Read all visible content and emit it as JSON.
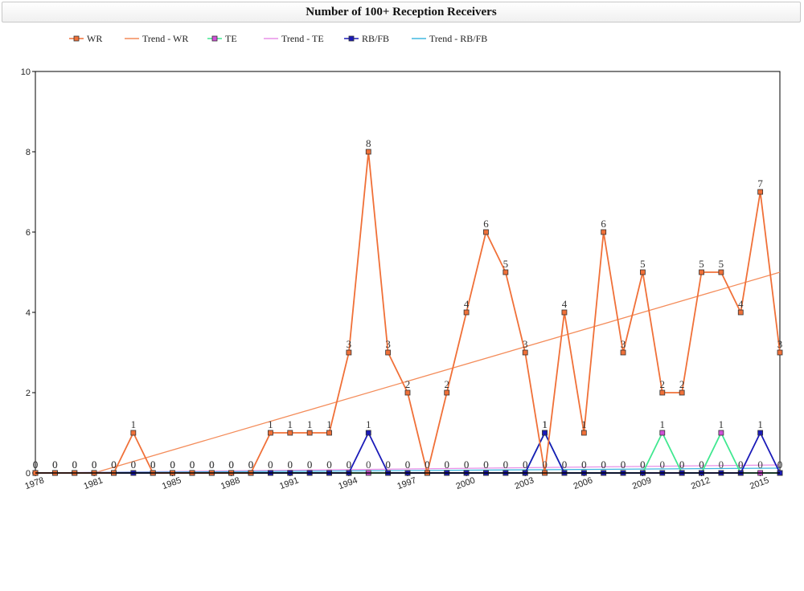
{
  "chart_data": {
    "type": "line",
    "title": "Number of 100+ Reception Receivers",
    "xlabel": "",
    "ylabel": "",
    "xlim": [
      1978,
      2016
    ],
    "ylim": [
      0,
      10
    ],
    "yticks": [
      0,
      2,
      4,
      6,
      8,
      10
    ],
    "xticks": [
      1978,
      1981,
      1985,
      1988,
      1991,
      1994,
      1997,
      2000,
      2003,
      2006,
      2009,
      2012,
      2015
    ],
    "xtick_labels": [
      "1978",
      "1981",
      "1985",
      "1988",
      "1991",
      "1994",
      "1997",
      "2000",
      "2003",
      "2006",
      "2009",
      "2012",
      "2015"
    ],
    "legend_position": "top-left",
    "grid": false,
    "x": [
      1978,
      1979,
      1980,
      1981,
      1982,
      1983,
      1984,
      1985,
      1986,
      1987,
      1988,
      1989,
      1990,
      1991,
      1992,
      1993,
      1994,
      1995,
      1996,
      1997,
      1998,
      1999,
      2000,
      2001,
      2002,
      2003,
      2004,
      2005,
      2006,
      2007,
      2008,
      2009,
      2010,
      2011,
      2012,
      2013,
      2014,
      2015,
      2016
    ],
    "series": [
      {
        "name": "WR",
        "color": "#f07038",
        "marker": "square",
        "labels": true,
        "values": [
          0,
          0,
          0,
          0,
          0,
          1,
          0,
          0,
          0,
          0,
          0,
          0,
          1,
          1,
          1,
          1,
          3,
          8,
          3,
          2,
          0,
          2,
          4,
          6,
          5,
          3,
          0,
          4,
          1,
          6,
          3,
          5,
          2,
          2,
          5,
          5,
          4,
          7,
          3,
          5
        ]
      },
      {
        "name": "Trend - WR",
        "color": "#f48c5a",
        "trend": true,
        "x": [
          1981,
          2016
        ],
        "values": [
          0,
          5
        ]
      },
      {
        "name": "TE",
        "color": "#40e890",
        "marker": "square",
        "marker_fill": "#d050d8",
        "labels": true,
        "values": [
          0,
          0,
          0,
          0,
          0,
          0,
          0,
          0,
          0,
          0,
          0,
          0,
          0,
          0,
          0,
          0,
          0,
          0,
          0,
          0,
          0,
          0,
          0,
          0,
          0,
          0,
          1,
          0,
          0,
          0,
          0,
          0,
          1,
          0,
          0,
          1,
          0,
          0,
          0,
          0
        ]
      },
      {
        "name": "Trend - TE",
        "color": "#e890e8",
        "trend": true,
        "x": [
          1978,
          2016
        ],
        "values": [
          0,
          0.2
        ]
      },
      {
        "name": "RB/FB",
        "color": "#1a1ab8",
        "marker": "square",
        "labels": true,
        "values": [
          0,
          0,
          0,
          0,
          0,
          0,
          0,
          0,
          0,
          0,
          0,
          0,
          0,
          0,
          0,
          0,
          0,
          1,
          0,
          0,
          0,
          0,
          0,
          0,
          0,
          0,
          1,
          0,
          0,
          0,
          0,
          0,
          0,
          0,
          0,
          0,
          0,
          1,
          0,
          0
        ]
      },
      {
        "name": "Trend - RB/FB",
        "color": "#40b8e0",
        "trend": true,
        "x": [
          1978,
          2016
        ],
        "values": [
          0,
          0.12
        ]
      }
    ]
  }
}
